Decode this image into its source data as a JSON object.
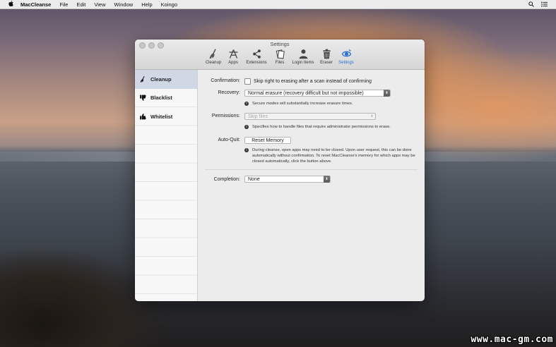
{
  "menubar": {
    "app_name": "MacCleanse",
    "items": [
      "File",
      "Edit",
      "View",
      "Window",
      "Help",
      "Koingo"
    ]
  },
  "window": {
    "title": "Settings",
    "toolbar": [
      {
        "label": "Cleanup",
        "icon": "broom-icon"
      },
      {
        "label": "Apps",
        "icon": "apps-icon"
      },
      {
        "label": "Extensions",
        "icon": "share-icon"
      },
      {
        "label": "Files",
        "icon": "files-icon"
      },
      {
        "label": "Login Items",
        "icon": "person-icon"
      },
      {
        "label": "Eraser",
        "icon": "trash-icon"
      },
      {
        "label": "Settings",
        "icon": "settings-icon",
        "active": true
      }
    ]
  },
  "sidebar": {
    "items": [
      {
        "label": "Cleanup",
        "icon": "broom-icon",
        "selected": true
      },
      {
        "label": "Blacklist",
        "icon": "thumbs-down-icon"
      },
      {
        "label": "Whitelist",
        "icon": "thumbs-up-icon"
      }
    ]
  },
  "settings": {
    "confirmation": {
      "label": "Confirmation:",
      "checkbox_text": "Skip right to erasing after a scan instead of confirming",
      "checked": false
    },
    "recovery": {
      "label": "Recovery:",
      "value": "Normal erasure (recovery difficult but not impossible)",
      "note": "Secure modes will substantially increase erasure times."
    },
    "permissions": {
      "label": "Permissions:",
      "value": "Skip files",
      "note": "Specifies how to handle files that require administrator permissions to erase."
    },
    "auto_quit": {
      "label": "Auto-Quit:",
      "button": "Reset Memory",
      "note": "During cleanse, open apps may need to be closed. Upon user request, this can be done automatically without confirmation. To reset MacCleanse's memory for which apps may be closed automatically, click the button above."
    },
    "completion": {
      "label": "Completion:",
      "value": "None"
    }
  },
  "watermark": "www.mac-gm.com",
  "colors": {
    "accent": "#2b6fd6",
    "selection": "#cfd8e4"
  }
}
